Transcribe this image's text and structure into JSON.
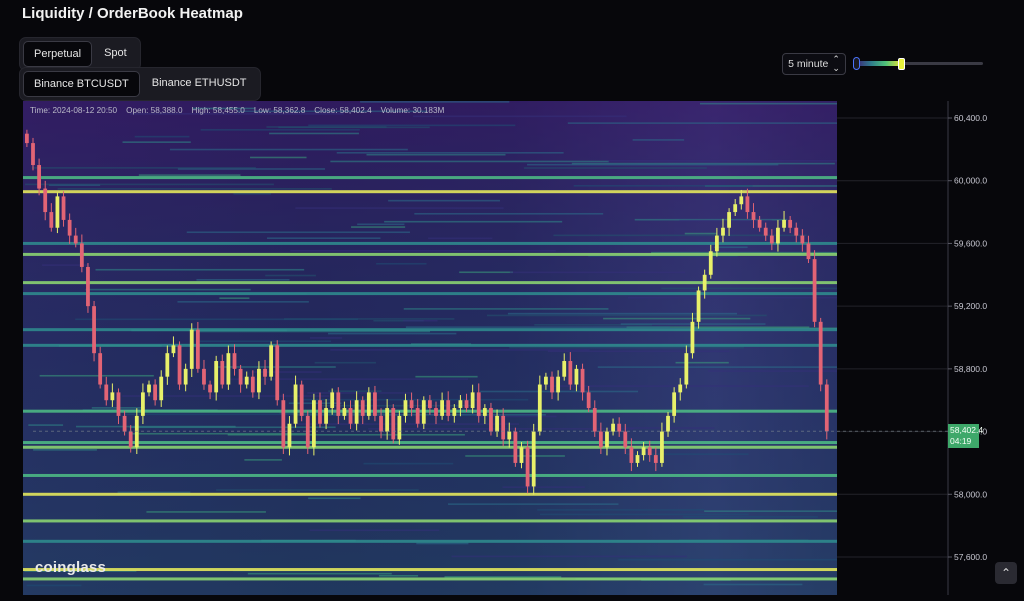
{
  "title": "Liquidity / OrderBook Heatmap",
  "market_tabs": [
    {
      "label": "Perpetual",
      "active": true
    },
    {
      "label": "Spot",
      "active": false
    }
  ],
  "pair_tabs": [
    {
      "label": "Binance BTCUSDT",
      "active": true
    },
    {
      "label": "Binance ETHUSDT",
      "active": false
    }
  ],
  "interval": {
    "label": "5 minute",
    "icon": "updown-chevron-icon"
  },
  "threshold_slider": {
    "value_fraction": 0.34
  },
  "ohlc": {
    "time": "Time: 2024-08-12 20:50",
    "open": "Open: 58,388.0",
    "high": "High: 58,455.0",
    "low": "Low: 58,362.8",
    "close": "Close: 58,402.4",
    "volume": "Volume: 30.183M"
  },
  "watermark": "coinglass",
  "current_price": {
    "price": "58,402.4",
    "countdown": "04:19",
    "color": "#3ea86a"
  },
  "colors": {
    "up": "#e8f06a",
    "down": "#e26475",
    "heat_low": "#2a1457",
    "heat_mid": "#2e6f8c",
    "heat_high": "#f0f05a"
  },
  "chart_data": {
    "type": "heatmap",
    "title": "",
    "ylim": [
      57400,
      60600
    ],
    "y_ticks": [
      "60,400.0",
      "60,000.0",
      "59,600.0",
      "59,200.0",
      "58,800.0",
      "58,400.0",
      "58,000.0",
      "57,600.0"
    ],
    "y_tick_values": [
      60400,
      60000,
      59600,
      59200,
      58800,
      58400,
      58000,
      57600
    ],
    "series": [
      {
        "name": "BTCUSDT close (5m)",
        "values": [
          60240,
          60100,
          59950,
          59800,
          59700,
          59900,
          59750,
          59650,
          59600,
          59450,
          59200,
          58900,
          58700,
          58600,
          58650,
          58500,
          58400,
          58300,
          58500,
          58650,
          58700,
          58600,
          58750,
          58900,
          58950,
          58700,
          58800,
          59050,
          58800,
          58700,
          58650,
          58850,
          58700,
          58900,
          58800,
          58700,
          58750,
          58650,
          58800,
          58750,
          58950,
          58600,
          58300,
          58450,
          58700,
          58500,
          58300,
          58600,
          58450,
          58550,
          58650,
          58500,
          58550,
          58450,
          58600,
          58500,
          58650,
          58500,
          58400,
          58550,
          58350,
          58500,
          58600,
          58550,
          58450,
          58600,
          58550,
          58500,
          58600,
          58500,
          58550,
          58600,
          58550,
          58650,
          58500,
          58550,
          58400,
          58500,
          58350,
          58400,
          58200,
          58300,
          58050,
          58400,
          58700,
          58750,
          58650,
          58750,
          58850,
          58700,
          58800,
          58650,
          58550,
          58400,
          58300,
          58400,
          58450,
          58400,
          58300,
          58200,
          58250,
          58300,
          58250,
          58200,
          58400,
          58500,
          58650,
          58700,
          58900,
          59100,
          59300,
          59400,
          59550,
          59650,
          59700,
          59800,
          59850,
          59900,
          59800,
          59750,
          59700,
          59650,
          59600,
          59700,
          59750,
          59700,
          59650,
          59600,
          59500,
          59100,
          58700,
          58402
        ]
      }
    ],
    "liquidity_bands": [
      {
        "price": 60020,
        "strength": 0.55
      },
      {
        "price": 59930,
        "strength": 0.9
      },
      {
        "price": 59600,
        "strength": 0.5
      },
      {
        "price": 59530,
        "strength": 0.8
      },
      {
        "price": 59350,
        "strength": 0.75
      },
      {
        "price": 59280,
        "strength": 0.45
      },
      {
        "price": 59050,
        "strength": 0.5
      },
      {
        "price": 58950,
        "strength": 0.4
      },
      {
        "price": 58530,
        "strength": 0.6
      },
      {
        "price": 58330,
        "strength": 0.7
      },
      {
        "price": 58300,
        "strength": 0.85
      },
      {
        "price": 58120,
        "strength": 0.55
      },
      {
        "price": 58000,
        "strength": 0.95
      },
      {
        "price": 57830,
        "strength": 0.75
      },
      {
        "price": 57700,
        "strength": 0.45
      },
      {
        "price": 57520,
        "strength": 0.95
      },
      {
        "price": 57460,
        "strength": 0.8
      }
    ]
  }
}
